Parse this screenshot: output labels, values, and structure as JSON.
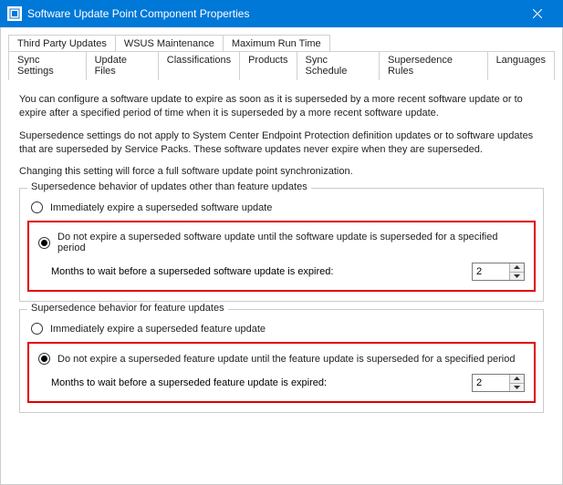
{
  "window": {
    "title": "Software Update Point Component Properties"
  },
  "tabs": {
    "row1": [
      {
        "label": "Third Party Updates"
      },
      {
        "label": "WSUS Maintenance"
      },
      {
        "label": "Maximum Run Time"
      }
    ],
    "row2": [
      {
        "label": "Sync Settings"
      },
      {
        "label": "Update Files"
      },
      {
        "label": "Classifications"
      },
      {
        "label": "Products"
      },
      {
        "label": "Sync Schedule"
      },
      {
        "label": "Supersedence Rules",
        "selected": true
      },
      {
        "label": "Languages"
      }
    ]
  },
  "intro": {
    "p1": "You can configure a software update to expire as soon as it is superseded by a more recent software update or to expire after a specified period of time when it is superseded by a more recent software update.",
    "p2": "Supersedence settings do not apply to System Center Endpoint Protection definition updates or to software updates that are superseded by Service Packs. These software updates never expire when they are superseded.",
    "p3": "Changing this setting will force a full software update point synchronization."
  },
  "group1": {
    "legend": "Supersedence behavior of updates other than feature updates",
    "opt1": "Immediately expire a superseded software update",
    "opt2": "Do not expire a superseded software update until the software update is superseded for a specified period",
    "wait_label": "Months to wait before a superseded software update is expired:",
    "wait_value": "2"
  },
  "group2": {
    "legend": "Supersedence behavior for feature updates",
    "opt1": "Immediately expire a superseded feature update",
    "opt2": "Do not expire a superseded feature update until the feature update is superseded for a specified period",
    "wait_label": "Months to wait before a superseded feature update is expired:",
    "wait_value": "2"
  }
}
